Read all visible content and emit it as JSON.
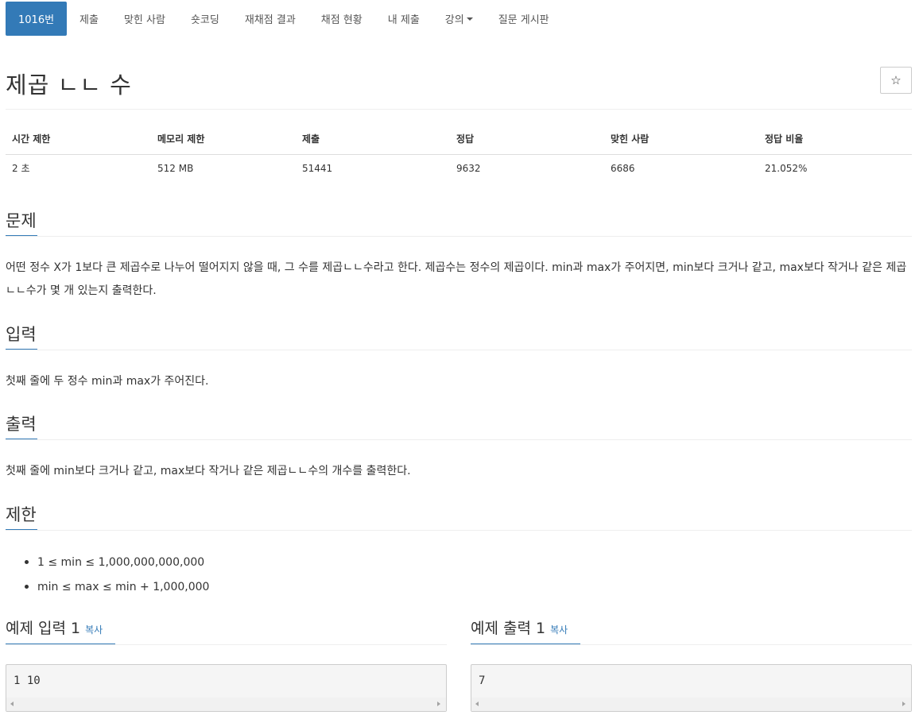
{
  "nav": {
    "items": [
      {
        "label": "1016번"
      },
      {
        "label": "제출"
      },
      {
        "label": "맞힌 사람"
      },
      {
        "label": "숏코딩"
      },
      {
        "label": "재채점 결과"
      },
      {
        "label": "채점 현황"
      },
      {
        "label": "내 제출"
      },
      {
        "label": "강의"
      },
      {
        "label": "질문 게시판"
      }
    ]
  },
  "problem": {
    "title": "제곱 ㄴㄴ 수",
    "star_icon": "☆"
  },
  "info": {
    "headers": [
      "시간 제한",
      "메모리 제한",
      "제출",
      "정답",
      "맞힌 사람",
      "정답 비율"
    ],
    "values": [
      "2 초",
      "512 MB",
      "51441",
      "9632",
      "6686",
      "21.052%"
    ]
  },
  "sections": {
    "description": {
      "title": "문제",
      "text": "어떤 정수 X가 1보다 큰 제곱수로 나누어 떨어지지 않을 때, 그 수를 제곱ㄴㄴ수라고 한다. 제곱수는 정수의 제곱이다. min과 max가 주어지면, min보다 크거나 같고, max보다 작거나 같은 제곱ㄴㄴ수가 몇 개 있는지 출력한다."
    },
    "input": {
      "title": "입력",
      "text": "첫째 줄에 두 정수 min과 max가 주어진다."
    },
    "output": {
      "title": "출력",
      "text": "첫째 줄에 min보다 크거나 같고, max보다 작거나 같은 제곱ㄴㄴ수의 개수를 출력한다."
    },
    "limits": {
      "title": "제한",
      "items": [
        "1 ≤ min ≤ 1,000,000,000,000",
        "min ≤ max ≤ min + 1,000,000"
      ]
    }
  },
  "samples": {
    "input": {
      "title": "예제 입력 1",
      "copy": "복사",
      "content": "1 10"
    },
    "output": {
      "title": "예제 출력 1",
      "copy": "복사",
      "content": "7"
    }
  },
  "colors": {
    "accent": "#337ab7",
    "sample_bg": "#f5f5f5"
  }
}
